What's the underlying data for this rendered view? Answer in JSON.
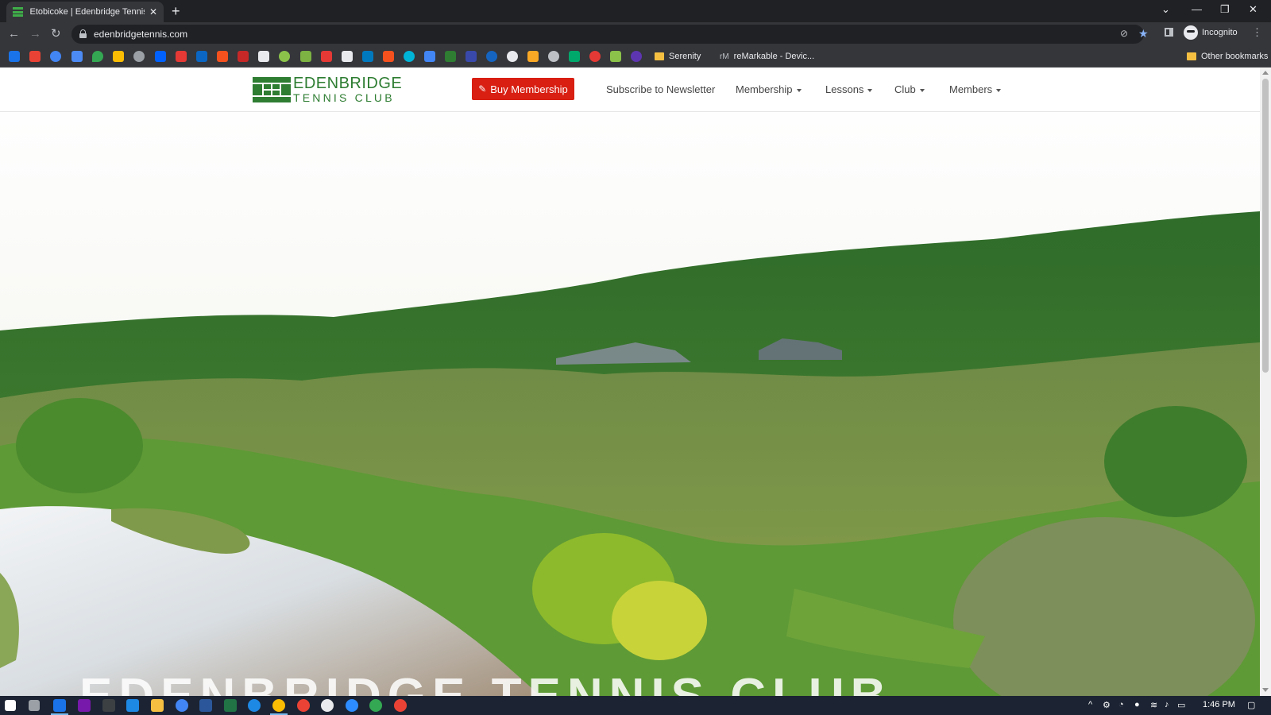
{
  "browser": {
    "tab_title": "Etobicoke | Edenbridge Tennis Club",
    "new_tab": "+",
    "url": "edenbridgetennis.com",
    "profile_label": "Incognito"
  },
  "bookmarks": {
    "items": [
      "Serenity",
      "reMarkable - Devic..."
    ],
    "other": "Other bookmarks"
  },
  "site": {
    "logo_line1": "EDENBRIDGE",
    "logo_line2": "TENNIS CLUB",
    "buy_button": "Buy Membership",
    "nav": [
      {
        "label": "Subscribe to Newsletter",
        "dropdown": false
      },
      {
        "label": "Membership",
        "dropdown": true
      },
      {
        "label": "Lessons",
        "dropdown": true
      },
      {
        "label": "Club",
        "dropdown": true
      },
      {
        "label": "Members",
        "dropdown": true
      }
    ],
    "hero_title": "EDENBRIDGE TENNIS CLUB",
    "brand_green": "#2e7d32",
    "cta_red": "#d81f12"
  },
  "taskbar": {
    "clock": "1:46 PM"
  }
}
